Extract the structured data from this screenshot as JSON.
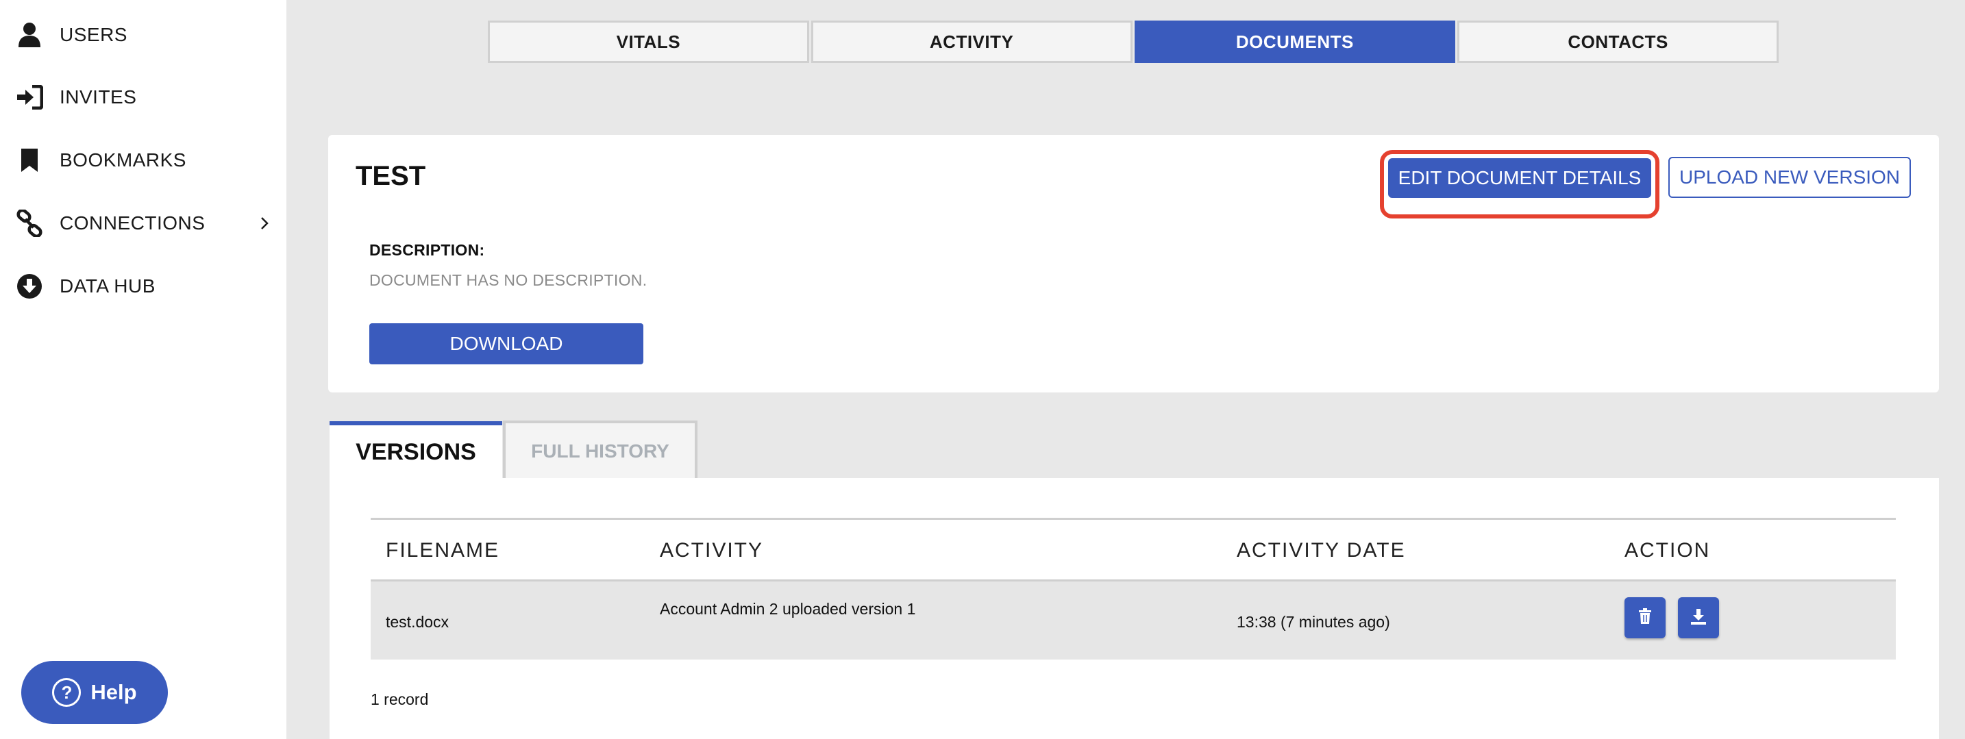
{
  "sidebar": {
    "items": [
      {
        "label": "USERS",
        "icon": "user-icon"
      },
      {
        "label": "INVITES",
        "icon": "sign-in-icon"
      },
      {
        "label": "BOOKMARKS",
        "icon": "bookmark-icon"
      },
      {
        "label": "CONNECTIONS",
        "icon": "link-icon"
      },
      {
        "label": "DATA HUB",
        "icon": "download-circle-icon"
      }
    ],
    "help_label": "Help"
  },
  "top_tabs": [
    {
      "label": "VITALS",
      "active": false
    },
    {
      "label": "ACTIVITY",
      "active": false
    },
    {
      "label": "DOCUMENTS",
      "active": true
    },
    {
      "label": "CONTACTS",
      "active": false
    }
  ],
  "document": {
    "title": "TEST",
    "edit_label": "EDIT DOCUMENT DETAILS",
    "upload_label": "UPLOAD NEW VERSION",
    "description_label": "DESCRIPTION:",
    "description_value": "DOCUMENT HAS NO DESCRIPTION.",
    "download_label": "DOWNLOAD"
  },
  "sub_tabs": {
    "versions": "VERSIONS",
    "history": "FULL HISTORY"
  },
  "versions_table": {
    "headers": {
      "filename": "FILENAME",
      "activity": "ACTIVITY",
      "date": "ACTIVITY DATE",
      "action": "ACTION"
    },
    "rows": [
      {
        "filename": "test.docx",
        "activity": "Account Admin 2 uploaded version 1",
        "date": "13:38 (7 minutes ago)"
      }
    ],
    "record_count": "1 record"
  },
  "colors": {
    "accent": "#3a5bbd",
    "highlight": "#e5412f"
  }
}
